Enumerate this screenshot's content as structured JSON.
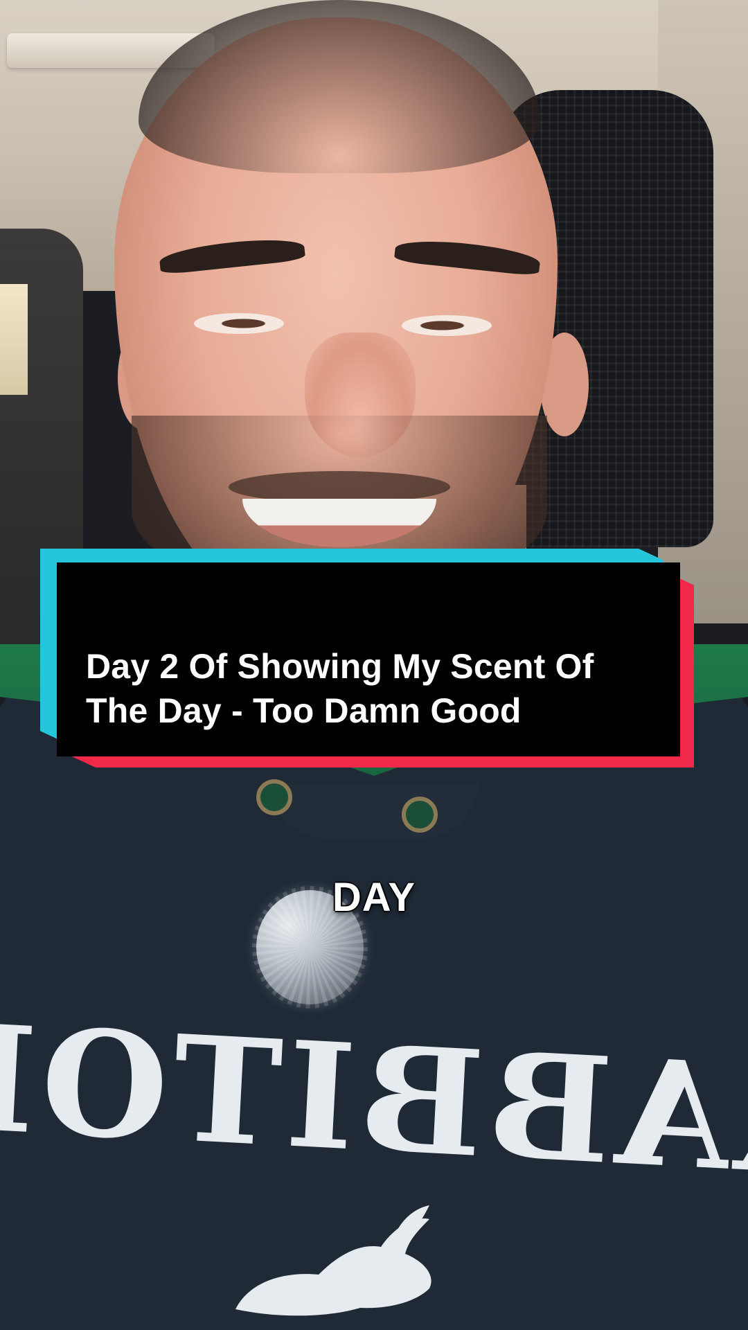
{
  "title_card": {
    "line1": "Day 2 Of Showing My Scent Of",
    "line2": "The Day - Too Damn Good"
  },
  "caption": {
    "text": "DAY"
  },
  "shirt": {
    "print_text": "RABBITOH"
  },
  "colors": {
    "card_background": "#000000",
    "card_cyan_accent": "#25c6dc",
    "card_red_accent": "#f0284a",
    "text": "#ffffff"
  }
}
